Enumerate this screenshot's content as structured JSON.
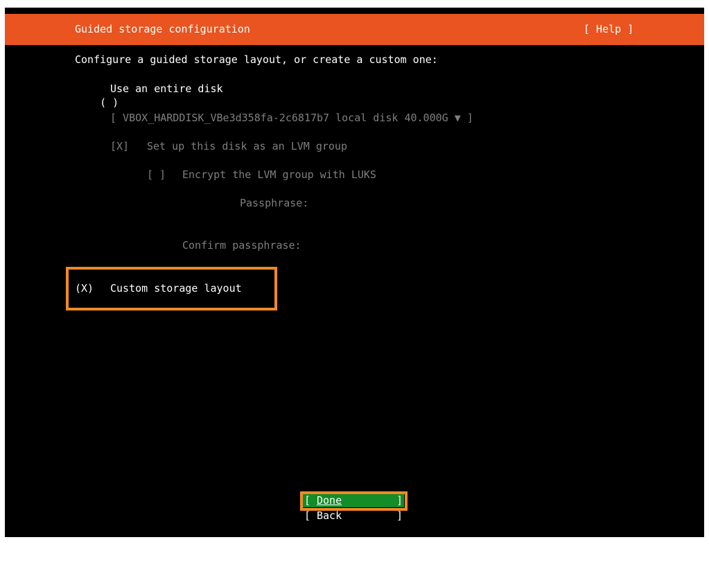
{
  "header": {
    "title": "Guided storage configuration",
    "help_label": "[ Help ]"
  },
  "main": {
    "intro": "Configure a guided storage layout, or create a custom one:",
    "entire_disk": {
      "marker": "( )",
      "label": "Use an entire disk"
    },
    "disk_select": {
      "value": "[ VBOX_HARDDISK_VBe3d358fa-2c6817b7 local disk 40.000G ▼ ]"
    },
    "lvm_option": {
      "marker": "[X]",
      "label": "Set up this disk as an LVM group"
    },
    "encrypt_option": {
      "marker": "[ ]",
      "label": "Encrypt the LVM group with LUKS"
    },
    "passphrase": {
      "label": "Passphrase:"
    },
    "confirm_passphrase": {
      "label": "Confirm passphrase:"
    },
    "custom_layout": {
      "marker": "(X)",
      "label": "Custom storage layout"
    }
  },
  "footer": {
    "done_label": "Done",
    "back_label": "Back"
  },
  "colors": {
    "header_bg": "#e95420",
    "done_bg": "#148c27",
    "highlight": "#f08a24",
    "dim_text": "#7f7f7f"
  }
}
